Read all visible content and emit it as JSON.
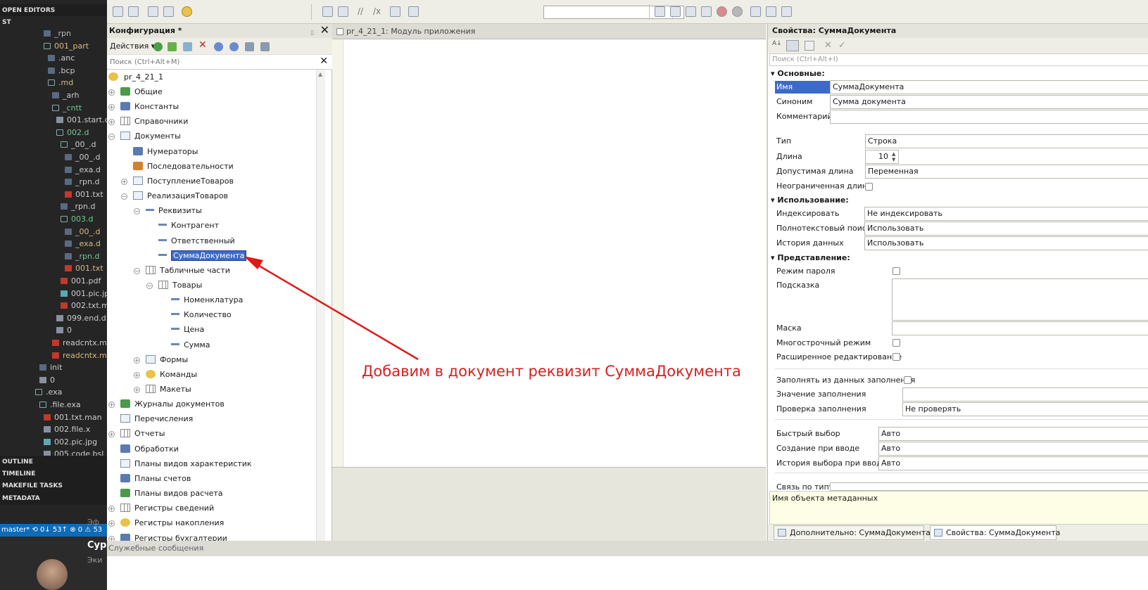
{
  "vscode": {
    "open_editors": "OPEN EDITORS",
    "section_st": "ST",
    "files": [
      {
        "label": "_rpn",
        "kind": "folder-closed",
        "indent": 62,
        "color": "#bbb"
      },
      {
        "label": "001_part",
        "kind": "folder",
        "indent": 62,
        "color": "#d7ba7d"
      },
      {
        "label": ".anc",
        "kind": "folder-closed",
        "indent": 68,
        "color": "#ccc"
      },
      {
        "label": ".bcp",
        "kind": "folder-closed",
        "indent": 68,
        "color": "#ccc"
      },
      {
        "label": ".md",
        "kind": "folder",
        "indent": 68,
        "color": "#d7ba7d"
      },
      {
        "label": "_arh",
        "kind": "folder-closed",
        "indent": 74,
        "color": "#ccc"
      },
      {
        "label": "_cntt",
        "kind": "folder",
        "indent": 74,
        "color": "#73c991"
      },
      {
        "label": "001.start.c",
        "kind": "file",
        "indent": 80,
        "color": "#ccc"
      },
      {
        "label": "002.d",
        "kind": "folder",
        "indent": 80,
        "color": "#73c991"
      },
      {
        "label": "_00_.d",
        "kind": "folder",
        "indent": 86,
        "color": "#ccc"
      },
      {
        "label": "_00_.d",
        "kind": "folder-closed",
        "indent": 92,
        "color": "#ccc"
      },
      {
        "label": "_exa.d",
        "kind": "folder-closed",
        "indent": 92,
        "color": "#ccc"
      },
      {
        "label": "_rpn.d",
        "kind": "folder-closed",
        "indent": 92,
        "color": "#ccc"
      },
      {
        "label": "001.txt",
        "kind": "file-red",
        "indent": 92,
        "color": "#ccc"
      },
      {
        "label": "_rpn.d",
        "kind": "folder-closed",
        "indent": 86,
        "color": "#ccc"
      },
      {
        "label": "003.d",
        "kind": "folder",
        "indent": 86,
        "color": "#73c991"
      },
      {
        "label": "_00_.d",
        "kind": "folder-closed",
        "indent": 92,
        "color": "#d7ba7d"
      },
      {
        "label": "_exa.d",
        "kind": "folder-closed",
        "indent": 92,
        "color": "#d7ba7d"
      },
      {
        "label": "_rpn.d",
        "kind": "folder-closed",
        "indent": 92,
        "color": "#73c991"
      },
      {
        "label": "001.txt",
        "kind": "file-red",
        "indent": 92,
        "color": "#d7ba7d"
      },
      {
        "label": "001.pdf",
        "kind": "file-red",
        "indent": 86,
        "color": "#ccc"
      },
      {
        "label": "001.pic.jp",
        "kind": "file-img",
        "indent": 86,
        "color": "#ccc"
      },
      {
        "label": "002.txt.m",
        "kind": "file-red",
        "indent": 86,
        "color": "#ccc"
      },
      {
        "label": "099.end.d",
        "kind": "file",
        "indent": 80,
        "color": "#ccc"
      },
      {
        "label": "0",
        "kind": "file",
        "indent": 80,
        "color": "#ccc"
      },
      {
        "label": "readcntx.m",
        "kind": "file-red",
        "indent": 74,
        "color": "#ccc"
      },
      {
        "label": "readcntx.m",
        "kind": "file-red",
        "indent": 74,
        "color": "#d7ba7d"
      },
      {
        "label": "init",
        "kind": "folder-closed",
        "indent": 56,
        "color": "#ccc"
      },
      {
        "label": "0",
        "kind": "file",
        "indent": 56,
        "color": "#ccc"
      },
      {
        "label": ".exa",
        "kind": "folder",
        "indent": 50,
        "color": "#ccc"
      },
      {
        "label": ".file.exa",
        "kind": "folder",
        "indent": 56,
        "color": "#ccc"
      },
      {
        "label": "001.txt.man",
        "kind": "file-red",
        "indent": 62,
        "color": "#ccc"
      },
      {
        "label": "002.file.x",
        "kind": "file",
        "indent": 62,
        "color": "#ccc"
      },
      {
        "label": "002.pic.jpg",
        "kind": "file-img",
        "indent": 62,
        "color": "#ccc"
      },
      {
        "label": "005.code.bsl",
        "kind": "file",
        "indent": 62,
        "color": "#ccc"
      }
    ],
    "outline": "OUTLINE",
    "timeline": "TIMELINE",
    "makefile": "MAKEFILE TASKS",
    "metadata": "METADATA",
    "status": "master* ⟲ 0↓ 53↑  ⊗ 0 ⚠ 53",
    "chat_line1": "Эф",
    "chat_line2": "Сур",
    "chat_line3": "Эки"
  },
  "cfg": {
    "title": "Конфигурация *",
    "actions_label": "Действия ▾",
    "search_placeholder": "Поиск (Ctrl+Alt+M)",
    "root": "pr_4_21_1",
    "tree": [
      {
        "label": "Общие",
        "icon": "grn",
        "level": 0,
        "exp": "+"
      },
      {
        "label": "Константы",
        "icon": "blu",
        "level": 0,
        "exp": "+"
      },
      {
        "label": "Справочники",
        "icon": "tbl",
        "level": 0,
        "exp": "+"
      },
      {
        "label": "Документы",
        "icon": "doc",
        "level": 0,
        "exp": "−"
      },
      {
        "label": "Нумераторы",
        "icon": "blu",
        "level": 1,
        "exp": ""
      },
      {
        "label": "Последовательности",
        "icon": "org",
        "level": 1,
        "exp": ""
      },
      {
        "label": "ПоступлениеТоваров",
        "icon": "doc",
        "level": 1,
        "exp": "+"
      },
      {
        "label": "РеализацияТоваров",
        "icon": "doc",
        "level": 1,
        "exp": "−"
      },
      {
        "label": "Реквизиты",
        "icon": "attr",
        "level": 2,
        "exp": "−"
      },
      {
        "label": "Контрагент",
        "icon": "attr",
        "level": 3,
        "exp": ""
      },
      {
        "label": "Ответственный",
        "icon": "attr",
        "level": 3,
        "exp": ""
      },
      {
        "label": "СуммаДокумента",
        "icon": "attr",
        "level": 3,
        "exp": "",
        "selected": true
      },
      {
        "label": "Табличные части",
        "icon": "tbl",
        "level": 2,
        "exp": "−"
      },
      {
        "label": "Товары",
        "icon": "tbl",
        "level": 3,
        "exp": "−"
      },
      {
        "label": "Номенклатура",
        "icon": "attr",
        "level": 4,
        "exp": ""
      },
      {
        "label": "Количество",
        "icon": "attr",
        "level": 4,
        "exp": ""
      },
      {
        "label": "Цена",
        "icon": "attr",
        "level": 4,
        "exp": ""
      },
      {
        "label": "Сумма",
        "icon": "attr",
        "level": 4,
        "exp": ""
      },
      {
        "label": "Формы",
        "icon": "doc",
        "level": 2,
        "exp": "+"
      },
      {
        "label": "Команды",
        "icon": "yel",
        "level": 2,
        "exp": "+"
      },
      {
        "label": "Макеты",
        "icon": "tbl",
        "level": 2,
        "exp": "+"
      },
      {
        "label": "Журналы документов",
        "icon": "grn",
        "level": 0,
        "exp": "+"
      },
      {
        "label": "Перечисления",
        "icon": "doc",
        "level": 0,
        "exp": ""
      },
      {
        "label": "Отчеты",
        "icon": "tbl",
        "level": 0,
        "exp": "+"
      },
      {
        "label": "Обработки",
        "icon": "blu",
        "level": 0,
        "exp": ""
      },
      {
        "label": "Планы видов характеристик",
        "icon": "doc",
        "level": 0,
        "exp": ""
      },
      {
        "label": "Планы счетов",
        "icon": "blu",
        "level": 0,
        "exp": ""
      },
      {
        "label": "Планы видов расчета",
        "icon": "grn",
        "level": 0,
        "exp": ""
      },
      {
        "label": "Регистры сведений",
        "icon": "tbl",
        "level": 0,
        "exp": "+"
      },
      {
        "label": "Регистры накопления",
        "icon": "yel",
        "level": 0,
        "exp": "+"
      },
      {
        "label": "Регистры бухгалтерии",
        "icon": "blu",
        "level": 0,
        "exp": "+"
      }
    ]
  },
  "module": {
    "tab_title": "pr_4_21_1: Модуль приложения"
  },
  "annotation": "Добавим в документ реквизит СуммаДокумента",
  "props": {
    "title": "Свойства: СуммаДокумента",
    "search_placeholder": "Поиск (Ctrl+Alt+I)",
    "sec_basic": "Основные:",
    "name_label": "Имя",
    "name_value": "СуммаДокумента",
    "synonym_label": "Синоним",
    "synonym_value": "Сумма документа",
    "comment_label": "Комментарий",
    "type_label": "Тип",
    "type_value": "Строка",
    "length_label": "Длина",
    "length_value": "10",
    "allowed_label": "Допустимая длина",
    "allowed_value": "Переменная",
    "unlimited_label": "Неограниченная длина",
    "sec_usage": "Использование:",
    "index_label": "Индексировать",
    "index_value": "Не индексировать",
    "fulltext_label": "Полнотекстовый поиск",
    "fulltext_value": "Использовать",
    "history_label": "История данных",
    "history_value": "Использовать",
    "sec_view": "Представление:",
    "password_label": "Режим пароля",
    "hint_label": "Подсказка",
    "mask_label": "Маска",
    "multiline_label": "Многострочный режим",
    "extedit_label": "Расширенное редактирование",
    "fillfrom_label": "Заполнять из данных заполнения",
    "fillvalue_label": "Значение заполнения",
    "fillcheck_label": "Проверка заполнения",
    "fillcheck_value": "Не проверять",
    "quick_label": "Быстрый выбор",
    "quick_value": "Авто",
    "create_label": "Создание при вводе",
    "create_value": "Авто",
    "hist_choice_label": "История выбора при вводе",
    "hist_choice_value": "Авто",
    "link_label": "Связь по типу",
    "desc": "Имя объекта метаданных",
    "tab_extra": "Дополнительно: СуммаДокумента",
    "tab_props": "Свойства: СуммаДокумента"
  },
  "messages": {
    "title": "Служебные сообщения"
  },
  "colors": {
    "accent_selection": "#3d6ac9",
    "annotation": "#d62020"
  }
}
